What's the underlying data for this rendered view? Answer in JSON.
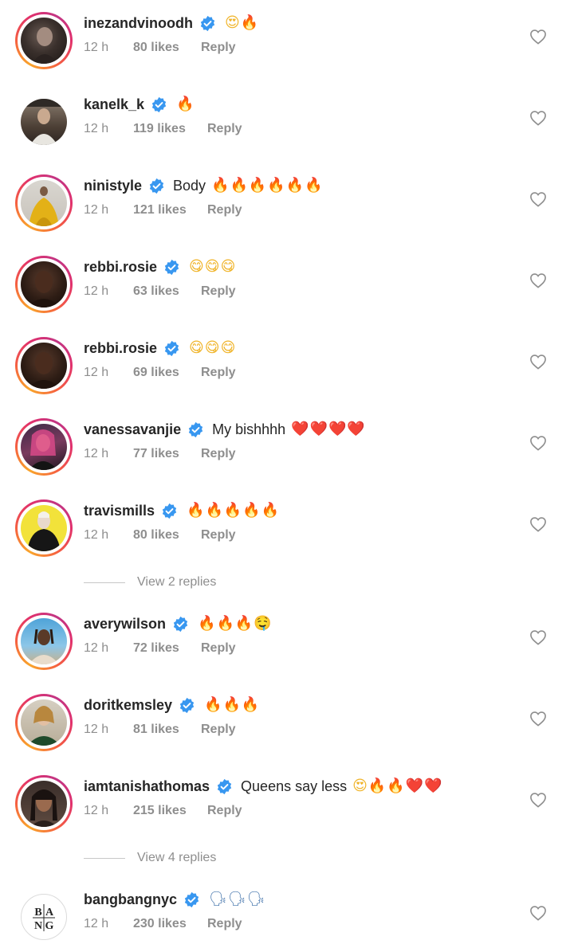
{
  "comments": [
    {
      "username": "inezandvinoodh",
      "text": "",
      "emojis": [
        "😍",
        "🔥"
      ],
      "time": "12 h",
      "likes": "80 likes",
      "reply": "Reply",
      "avatar": "portrait-dark"
    },
    {
      "username": "kanelk_k",
      "text": "",
      "emojis": [
        "🔥"
      ],
      "time": "12 h",
      "likes": "119 likes",
      "reply": "Reply",
      "avatar": "portrait-street"
    },
    {
      "username": "ninistyle",
      "text": "Body",
      "emojis": [
        "🔥",
        "🔥",
        "🔥",
        "🔥",
        "🔥",
        "🔥"
      ],
      "time": "12 h",
      "likes": "121 likes",
      "reply": "Reply",
      "avatar": "portrait-yellow-dress"
    },
    {
      "username": "rebbi.rosie",
      "text": "",
      "emojis": [
        "😋",
        "😋",
        "😋"
      ],
      "time": "12 h",
      "likes": "63 likes",
      "reply": "Reply",
      "avatar": "portrait-woman"
    },
    {
      "username": "rebbi.rosie",
      "text": "",
      "emojis": [
        "😋",
        "😋",
        "😋"
      ],
      "time": "12 h",
      "likes": "69 likes",
      "reply": "Reply",
      "avatar": "portrait-woman"
    },
    {
      "username": "vanessavanjie",
      "text": "My bishhhh",
      "emojis": [
        "❤️",
        "❤️",
        "❤️",
        "❤️"
      ],
      "time": "12 h",
      "likes": "77 likes",
      "reply": "Reply",
      "avatar": "portrait-pink"
    },
    {
      "username": "travismills",
      "text": "",
      "emojis": [
        "🔥",
        "🔥",
        "🔥",
        "🔥",
        "🔥"
      ],
      "time": "12 h",
      "likes": "80 likes",
      "reply": "Reply",
      "avatar": "portrait-yellow-bg"
    },
    {
      "username": "averywilson",
      "text": "",
      "emojis": [
        "🔥",
        "🔥",
        "🔥",
        "🤤"
      ],
      "time": "12 h",
      "likes": "72 likes",
      "reply": "Reply",
      "avatar": "portrait-sky"
    },
    {
      "username": "doritkemsley",
      "text": "",
      "emojis": [
        "🔥",
        "🔥",
        "🔥"
      ],
      "time": "12 h",
      "likes": "81 likes",
      "reply": "Reply",
      "avatar": "portrait-blonde"
    },
    {
      "username": "iamtanishathomas",
      "text": "Queens say less",
      "emojis": [
        "😍",
        "🔥",
        "🔥",
        "❤️",
        "❤️"
      ],
      "time": "12 h",
      "likes": "215 likes",
      "reply": "Reply",
      "avatar": "portrait-selfie"
    },
    {
      "username": "bangbangnyc",
      "text": "",
      "emojis": [
        "🗣",
        "🗣",
        "🗣"
      ],
      "time": "12 h",
      "likes": "230 likes",
      "reply": "Reply",
      "avatar": "bang-logo"
    }
  ],
  "view_replies": [
    {
      "label": "View 2 replies"
    },
    {
      "label": "View 4 replies"
    }
  ],
  "logo_text": [
    "B",
    "A",
    "N",
    "G"
  ],
  "colors": {
    "verified": "#3897f0",
    "meta": "#8e8e8e",
    "text": "#262626",
    "fire": "#f5780f",
    "heart": "#d7141f"
  },
  "icons": {
    "verified": "verified-badge-icon",
    "like": "heart-outline-icon"
  }
}
